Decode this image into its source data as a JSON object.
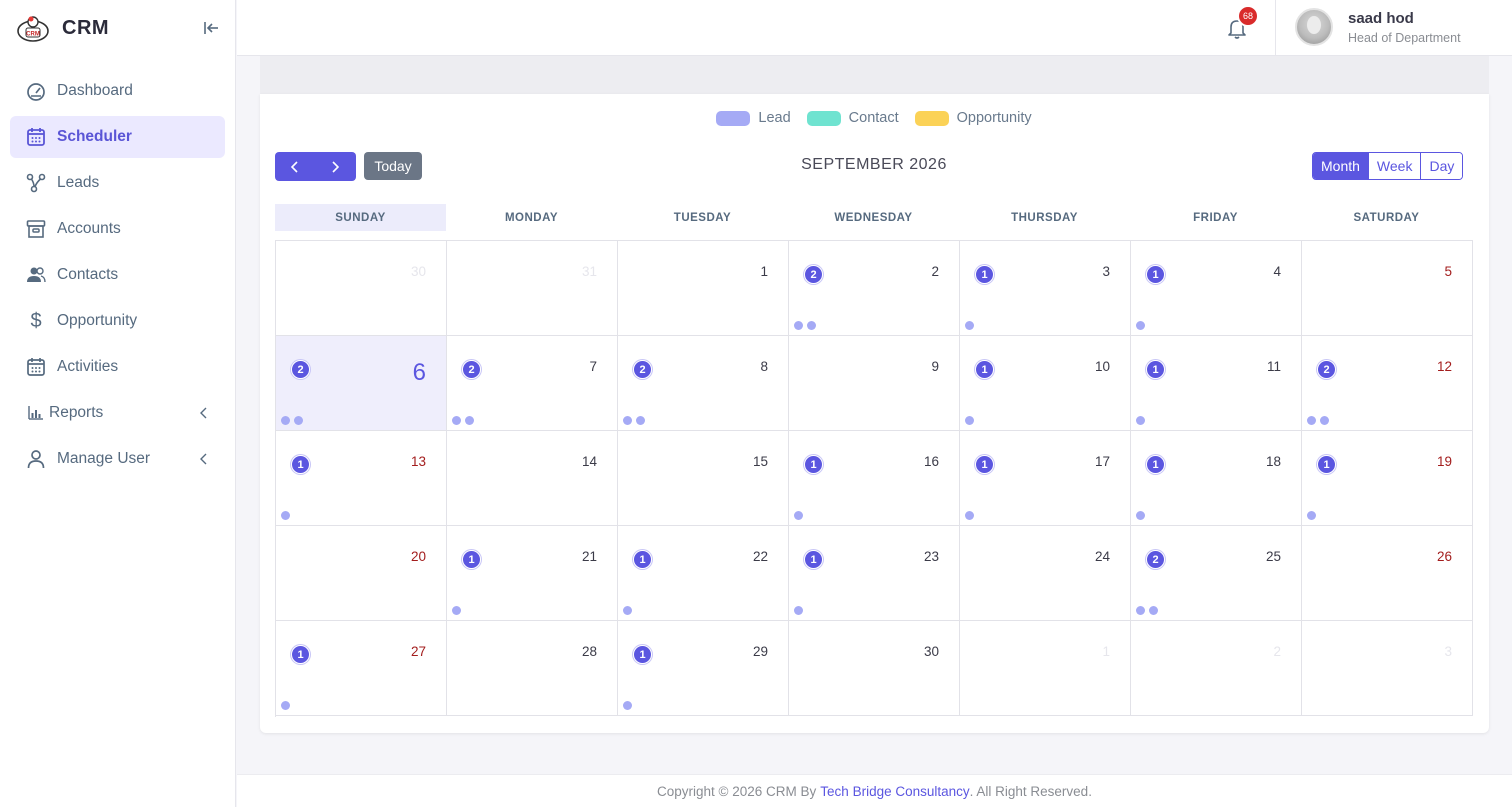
{
  "brand": {
    "name": "CRM"
  },
  "sidebar": {
    "items": [
      {
        "label": "Dashboard",
        "icon": "dashboard-icon"
      },
      {
        "label": "Scheduler",
        "icon": "calendar-icon",
        "active": true
      },
      {
        "label": "Leads",
        "icon": "leads-icon"
      },
      {
        "label": "Accounts",
        "icon": "archive-icon"
      },
      {
        "label": "Contacts",
        "icon": "contacts-icon"
      },
      {
        "label": "Opportunity",
        "icon": "dollar-icon"
      },
      {
        "label": "Activities",
        "icon": "calendar-icon"
      },
      {
        "label": "Reports",
        "icon": "bar-chart-icon",
        "has_submenu": true
      },
      {
        "label": "Manage User",
        "icon": "user-icon",
        "has_submenu": true
      }
    ]
  },
  "navbar": {
    "notification_count": "68",
    "user_name": "saad hod",
    "user_role": "Head of Department"
  },
  "calendar": {
    "legend": [
      {
        "label": "Lead",
        "color": "#a5aaf5"
      },
      {
        "label": "Contact",
        "color": "#6fe3d0"
      },
      {
        "label": "Opportunity",
        "color": "#fbd257"
      }
    ],
    "today_label": "Today",
    "prev_label": "‹",
    "next_label": "›",
    "title": "SEPTEMBER 2026",
    "views": [
      "Month",
      "Week",
      "Day"
    ],
    "active_view": "Month",
    "weekdays": [
      "SUNDAY",
      "MONDAY",
      "TUESDAY",
      "WEDNESDAY",
      "THURSDAY",
      "FRIDAY",
      "SATURDAY"
    ],
    "weeks": [
      [
        {
          "day": "30",
          "muted": true,
          "count": 0
        },
        {
          "day": "31",
          "muted": true,
          "count": 0
        },
        {
          "day": "1",
          "count": 0
        },
        {
          "day": "2",
          "count": 2
        },
        {
          "day": "3",
          "count": 1
        },
        {
          "day": "4",
          "count": 1
        },
        {
          "day": "5",
          "count": 0
        }
      ],
      [
        {
          "day": "6",
          "today": true,
          "count": 2
        },
        {
          "day": "7",
          "count": 2
        },
        {
          "day": "8",
          "count": 2
        },
        {
          "day": "9",
          "count": 0
        },
        {
          "day": "10",
          "count": 1
        },
        {
          "day": "11",
          "count": 1
        },
        {
          "day": "12",
          "count": 2
        }
      ],
      [
        {
          "day": "13",
          "count": 1
        },
        {
          "day": "14",
          "count": 0
        },
        {
          "day": "15",
          "count": 0
        },
        {
          "day": "16",
          "count": 1
        },
        {
          "day": "17",
          "count": 1
        },
        {
          "day": "18",
          "count": 1
        },
        {
          "day": "19",
          "count": 1
        }
      ],
      [
        {
          "day": "20",
          "count": 0
        },
        {
          "day": "21",
          "count": 1
        },
        {
          "day": "22",
          "count": 1
        },
        {
          "day": "23",
          "count": 1
        },
        {
          "day": "24",
          "count": 0
        },
        {
          "day": "25",
          "count": 2
        },
        {
          "day": "26",
          "count": 0
        }
      ],
      [
        {
          "day": "27",
          "count": 1
        },
        {
          "day": "28",
          "count": 0
        },
        {
          "day": "29",
          "count": 1
        },
        {
          "day": "30",
          "count": 0
        },
        {
          "day": "1",
          "muted": true,
          "count": 0
        },
        {
          "day": "2",
          "muted": true,
          "count": 0
        },
        {
          "day": "3",
          "muted": true,
          "count": 0
        }
      ]
    ]
  },
  "footer": {
    "prefix": "Copyright © 2026 CRM By",
    "link": "Tech Bridge Consultancy",
    "suffix": ". All Right Reserved."
  }
}
